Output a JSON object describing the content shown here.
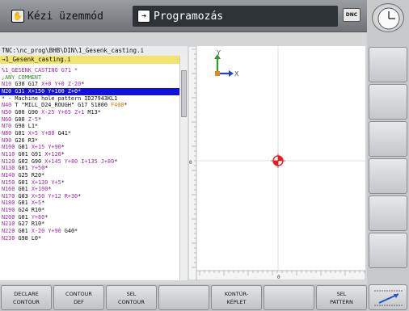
{
  "header": {
    "mode_manual": "Kézi üzemmód",
    "mode_programming": "Programozás",
    "dnc_label": "DNC"
  },
  "program": {
    "path": "TNC:\\nc_prog\\BHB\\DIN\\1_Gesenk_casting.i",
    "file_tab": "→1_Gesenk_casting.i",
    "lines": [
      "%1_GESENK_CASTING G71 *",
      ";ANY COMMENT",
      "N10 G30 G17 X+0 Y+0 Z-20*",
      "N20 G31 X+150 Y+100 Z+0*",
      "* - Machine hole pattern ID27943KL1",
      "N40 T \"MILL_D24_ROUGH\" G17 S1800 F400*",
      "N50 G00 G90 X-25 Y+65 Z+1 M13*",
      "N60 G00 Z-5*",
      "N70 G98 L1*",
      "N80 G01 X+5 Y+80 G41*",
      "N90 G26 R3*",
      "N100 G01 X+15 Y+90*",
      "N110 G01 G91 X+120*",
      "N120 G02 G90 X+145 Y+80 I+135 J+80*",
      "N130 G01 Y+50*",
      "N140 G25 R20*",
      "N150 G01 X+130 Y+5*",
      "N160 G01 X+100*",
      "N170 G03 X+50 Y+12 R+30*",
      "N180 G01 X+5*",
      "N190 G24 R10*",
      "N200 G01 Y+80*",
      "N210 G27 R10*",
      "N220 G01 X-20 Y+90 G40*",
      "N230 G98 L0*"
    ],
    "selected_line": 3
  },
  "graphics": {
    "axis_y": "Y",
    "axis_x": "X",
    "ruler_zero_left": "0",
    "ruler_zero_bottom": "0"
  },
  "softkeys": [
    {
      "l1": "DECLARE",
      "l2": "CONTOUR"
    },
    {
      "l1": "CONTOUR",
      "l2": "DEF"
    },
    {
      "l1": "SEL",
      "l2": "CONTOUR"
    },
    {
      "l1": "",
      "l2": ""
    },
    {
      "l1": "KONTÚR-",
      "l2": "KÉPLET"
    },
    {
      "l1": "",
      "l2": ""
    },
    {
      "l1": "SEL",
      "l2": "PATTERN"
    }
  ],
  "icons": {
    "manual_mode": "hand-icon",
    "programming_mode": "program-icon",
    "clock": "clock-icon",
    "datum": "datum-crosshair-icon",
    "next_row": "softkey-row-arrow-icon"
  },
  "colors": {
    "selected_line": "#1010e0",
    "block_number": "#a12aa8",
    "file_tab": "#f2e36a",
    "datum": "#e02020"
  }
}
